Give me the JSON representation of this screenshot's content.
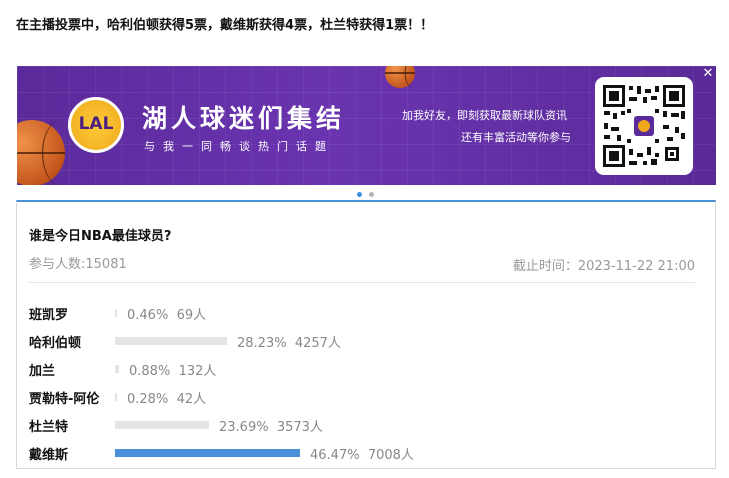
{
  "headline": "在主播投票中，哈利伯顿获得5票，戴维斯获得4票，杜兰特获得1票！！",
  "banner": {
    "logo_text": "LAL",
    "title": "湖人球迷们集结",
    "subtitle": "与我一同畅谈热门话题",
    "right_line1": "加我好友，即刻获取最新球队资讯",
    "right_line2": "还有丰富活动等你参与",
    "close_glyph": "✕",
    "qr_icon": "qr-code"
  },
  "carousel": {
    "active_index": 0,
    "count": 2
  },
  "poll": {
    "question": "谁是今日NBA最佳球员?",
    "participants": "参与人数:15081",
    "deadline": "截止时间：2023-11-22 21:00",
    "accent_color": "#4a90d9",
    "bar_gray": "#e4e4e4",
    "options": [
      {
        "name": "班凯罗",
        "percent": "0.46%",
        "votes": "69人",
        "fraction": 0.0046,
        "highlight": false
      },
      {
        "name": "哈利伯顿",
        "percent": "28.23%",
        "votes": "4257人",
        "fraction": 0.2823,
        "highlight": false
      },
      {
        "name": "加兰",
        "percent": "0.88%",
        "votes": "132人",
        "fraction": 0.0088,
        "highlight": false
      },
      {
        "name": "贾勒特-阿伦",
        "percent": "0.28%",
        "votes": "42人",
        "fraction": 0.0028,
        "highlight": false
      },
      {
        "name": "杜兰特",
        "percent": "23.69%",
        "votes": "3573人",
        "fraction": 0.2369,
        "highlight": false
      },
      {
        "name": "戴维斯",
        "percent": "46.47%",
        "votes": "7008人",
        "fraction": 0.4647,
        "highlight": true
      }
    ]
  }
}
